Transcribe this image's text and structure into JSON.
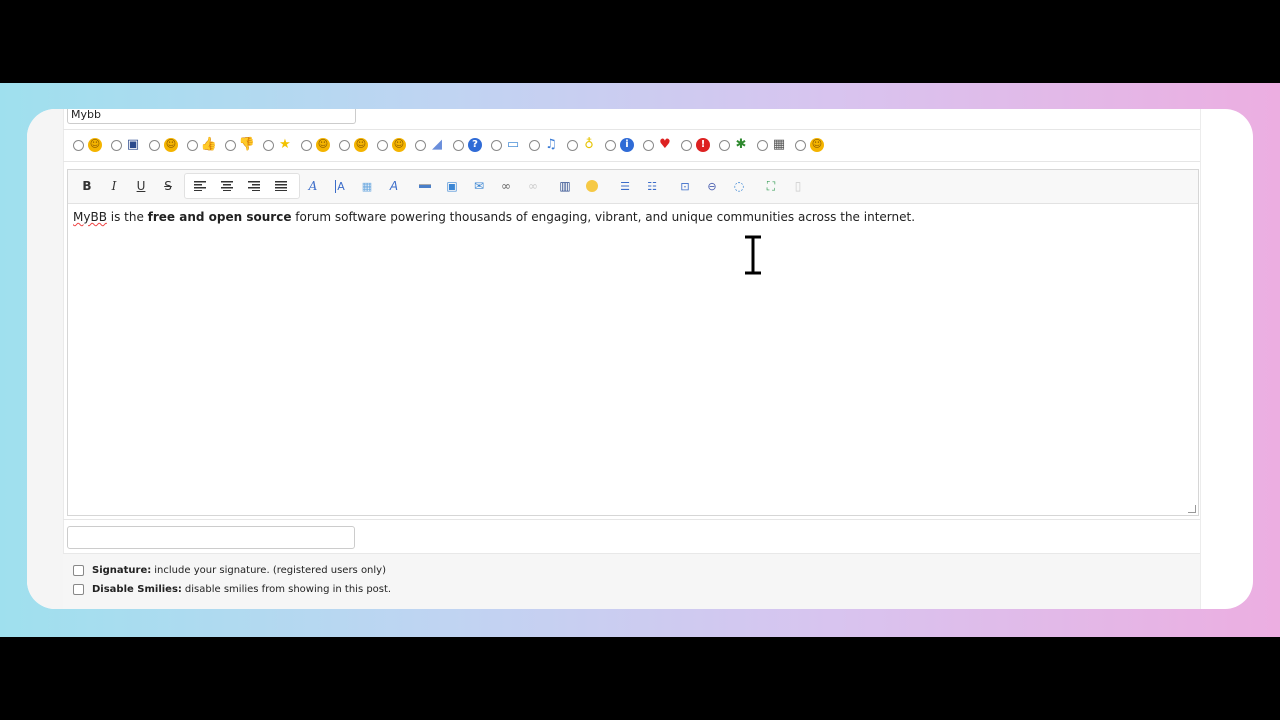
{
  "subject": {
    "value": "Mybb"
  },
  "post_icons": [
    {
      "name": "smile-icon",
      "glyph": "☺",
      "color": "#f4b400"
    },
    {
      "name": "video-icon",
      "glyph": "▣",
      "color": "#2b4a8c"
    },
    {
      "name": "tongue-icon",
      "glyph": "☺",
      "color": "#f4b400"
    },
    {
      "name": "thumbs-up-icon",
      "glyph": "👍",
      "color": "#e2874b"
    },
    {
      "name": "thumbs-down-icon",
      "glyph": "👎",
      "color": "#e2874b"
    },
    {
      "name": "star-icon",
      "glyph": "★",
      "color": "#f2c200"
    },
    {
      "name": "grin-icon",
      "glyph": "☺",
      "color": "#f4b400"
    },
    {
      "name": "shocked-icon",
      "glyph": "☺",
      "color": "#f4b400"
    },
    {
      "name": "happy-icon",
      "glyph": "☺",
      "color": "#f4b400"
    },
    {
      "name": "rainbow-icon",
      "glyph": "◢",
      "color": "#6a8edb"
    },
    {
      "name": "question-icon",
      "glyph": "?",
      "color": "#2f6bd6"
    },
    {
      "name": "image-icon",
      "glyph": "▭",
      "color": "#4a8fd6"
    },
    {
      "name": "music-icon",
      "glyph": "♫",
      "color": "#3a7bd5"
    },
    {
      "name": "lightbulb-icon",
      "glyph": "♁",
      "color": "#e6c300"
    },
    {
      "name": "info-icon",
      "glyph": "i",
      "color": "#2f6bd6"
    },
    {
      "name": "heart-icon",
      "glyph": "♥",
      "color": "#d22"
    },
    {
      "name": "exclamation-icon",
      "glyph": "!",
      "color": "#d22"
    },
    {
      "name": "bug-icon",
      "glyph": "✱",
      "color": "#2f8a2f"
    },
    {
      "name": "film-icon",
      "glyph": "▦",
      "color": "#555"
    },
    {
      "name": "laugh-icon",
      "glyph": "☺",
      "color": "#f4b400"
    }
  ],
  "toolbar": {
    "bold": "B",
    "italic": "I",
    "underline": "U",
    "strike": "S",
    "font": "A",
    "size": "A"
  },
  "editor": {
    "brand": "MyBB",
    "text_1": " is the ",
    "bold_text": "free and open source",
    "text_2": " forum software powering thousands of engaging, vibrant, and unique communities across the internet."
  },
  "options": {
    "signature_label": "Signature:",
    "signature_desc": "include your signature. (registered users only)",
    "smilies_label": "Disable Smilies:",
    "smilies_desc": "disable smilies from showing in this post."
  }
}
